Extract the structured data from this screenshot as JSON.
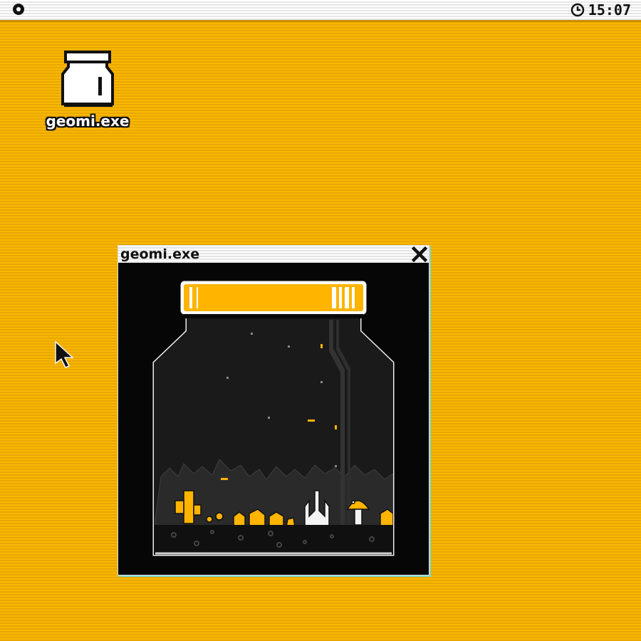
{
  "menubar": {
    "clock": "15:07"
  },
  "desktop": {
    "icon_label": "geomi.exe"
  },
  "window": {
    "title": "geomi.exe"
  },
  "colors": {
    "desktop": "#f6b300",
    "accent": "#ffb400",
    "window_bg": "#000000",
    "cyan_shadow": "#7adbd0"
  },
  "icons": [
    "apple-dot-icon",
    "clock-icon",
    "jar-icon",
    "cursor-icon",
    "close-icon"
  ]
}
